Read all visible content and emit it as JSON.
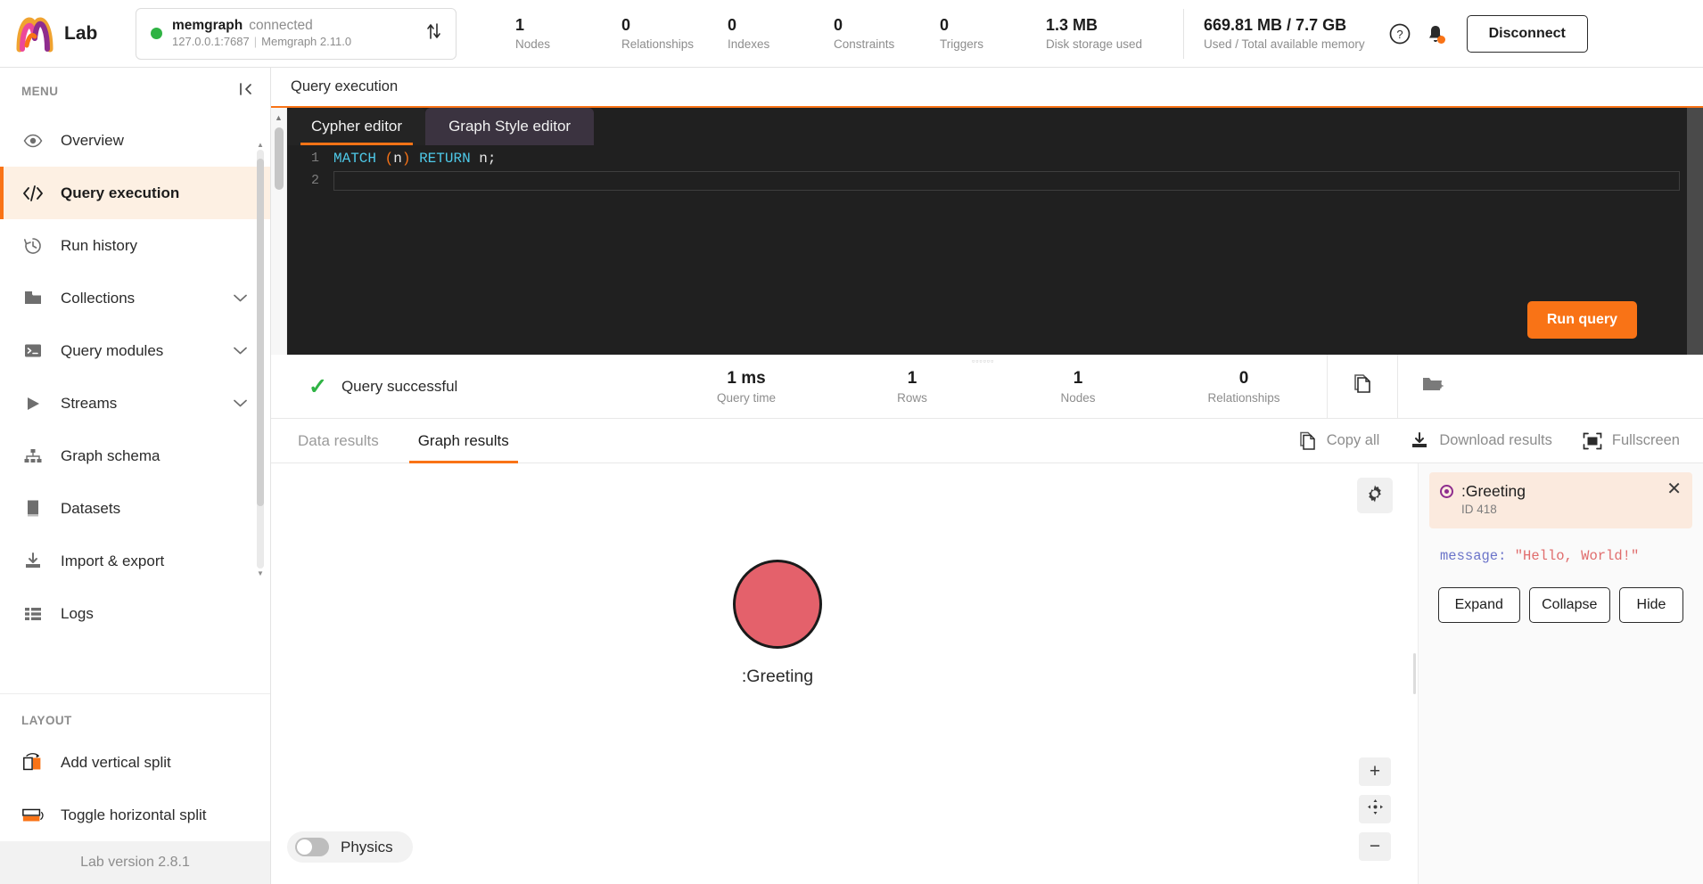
{
  "header": {
    "brand": "Lab",
    "logo_icon": "memgraph-logo-icon",
    "connection": {
      "status_dot": "status-dot-green",
      "name": "memgraph",
      "status": "connected",
      "address": "127.0.0.1:7687",
      "separator": "|",
      "version": "Memgraph 2.11.0",
      "swap_icon": "swap-vertical-icon"
    },
    "stats": [
      {
        "value": "1",
        "label": "Nodes"
      },
      {
        "value": "0",
        "label": "Relationships"
      },
      {
        "value": "0",
        "label": "Indexes"
      },
      {
        "value": "0",
        "label": "Constraints"
      },
      {
        "value": "0",
        "label": "Triggers"
      },
      {
        "value": "1.3 MB",
        "label": "Disk storage used"
      }
    ],
    "memory": {
      "value": "669.81 MB / 7.7 GB",
      "label": "Used / Total available memory"
    },
    "help_icon": "help-circle-icon",
    "bell_icon": "notification-bell-icon",
    "disconnect_label": "Disconnect"
  },
  "sidebar": {
    "menu_title": "MENU",
    "collapse_icon": "collapse-sidebar-icon",
    "items": [
      {
        "label": "Overview",
        "icon": "eye-icon",
        "chevron": false
      },
      {
        "label": "Query execution",
        "icon": "code-icon",
        "chevron": false
      },
      {
        "label": "Run history",
        "icon": "history-icon",
        "chevron": false
      },
      {
        "label": "Collections",
        "icon": "folder-icon",
        "chevron": true
      },
      {
        "label": "Query modules",
        "icon": "terminal-icon",
        "chevron": true
      },
      {
        "label": "Streams",
        "icon": "play-icon",
        "chevron": true
      },
      {
        "label": "Graph schema",
        "icon": "schema-icon",
        "chevron": false
      },
      {
        "label": "Datasets",
        "icon": "book-icon",
        "chevron": false
      },
      {
        "label": "Import & export",
        "icon": "download-icon",
        "chevron": false
      },
      {
        "label": "Logs",
        "icon": "list-icon",
        "chevron": false
      }
    ],
    "layout_title": "LAYOUT",
    "layout_items": [
      {
        "label": "Add vertical split",
        "icon": "vertical-split-icon"
      },
      {
        "label": "Toggle horizontal split",
        "icon": "horizontal-split-icon"
      }
    ],
    "version": "Lab version 2.8.1"
  },
  "main": {
    "title": "Query execution",
    "editor": {
      "tabs": [
        {
          "label": "Cypher editor",
          "active": true
        },
        {
          "label": "Graph Style editor",
          "active": false
        }
      ],
      "lines": [
        {
          "number": "1",
          "keyword1": "MATCH",
          "paren_open": "(",
          "var": "n",
          "paren_close": ")",
          "keyword2": "RETURN",
          "tail": " n;"
        },
        {
          "number": "2",
          "text": ""
        }
      ],
      "run_label": "Run query"
    },
    "status": {
      "check_icon": "check-icon",
      "text": "Query successful",
      "metrics": [
        {
          "value": "1 ms",
          "label": "Query time"
        },
        {
          "value": "1",
          "label": "Rows"
        },
        {
          "value": "1",
          "label": "Nodes"
        },
        {
          "value": "0",
          "label": "Relationships"
        }
      ],
      "copy_icon": "copy-icon",
      "save_icon": "save-to-collection-icon"
    },
    "results": {
      "tabs": [
        {
          "label": "Data results",
          "active": false
        },
        {
          "label": "Graph results",
          "active": true
        }
      ],
      "actions": [
        {
          "label": "Copy all",
          "icon": "copy-icon"
        },
        {
          "label": "Download results",
          "icon": "download-icon"
        },
        {
          "label": "Fullscreen",
          "icon": "fullscreen-icon"
        }
      ],
      "canvas": {
        "settings_icon": "gear-icon",
        "node": {
          "label": ":Greeting",
          "color": "#e4616b"
        },
        "zoom_in": "+",
        "zoom_fit": "fit-icon",
        "zoom_out": "−",
        "physics_label": "Physics",
        "physics_on": false
      },
      "node_panel": {
        "marker_icon": "node-marker-icon",
        "title": ":Greeting",
        "id": "ID 418",
        "close_icon": "close-icon",
        "property_key": "message:",
        "property_value": "\"Hello, World!\"",
        "buttons": [
          "Expand",
          "Collapse",
          "Hide"
        ]
      }
    }
  },
  "colors": {
    "accent": "#f97316",
    "success": "#2fb344",
    "node": "#e4616b",
    "editor_bg": "#202020"
  }
}
